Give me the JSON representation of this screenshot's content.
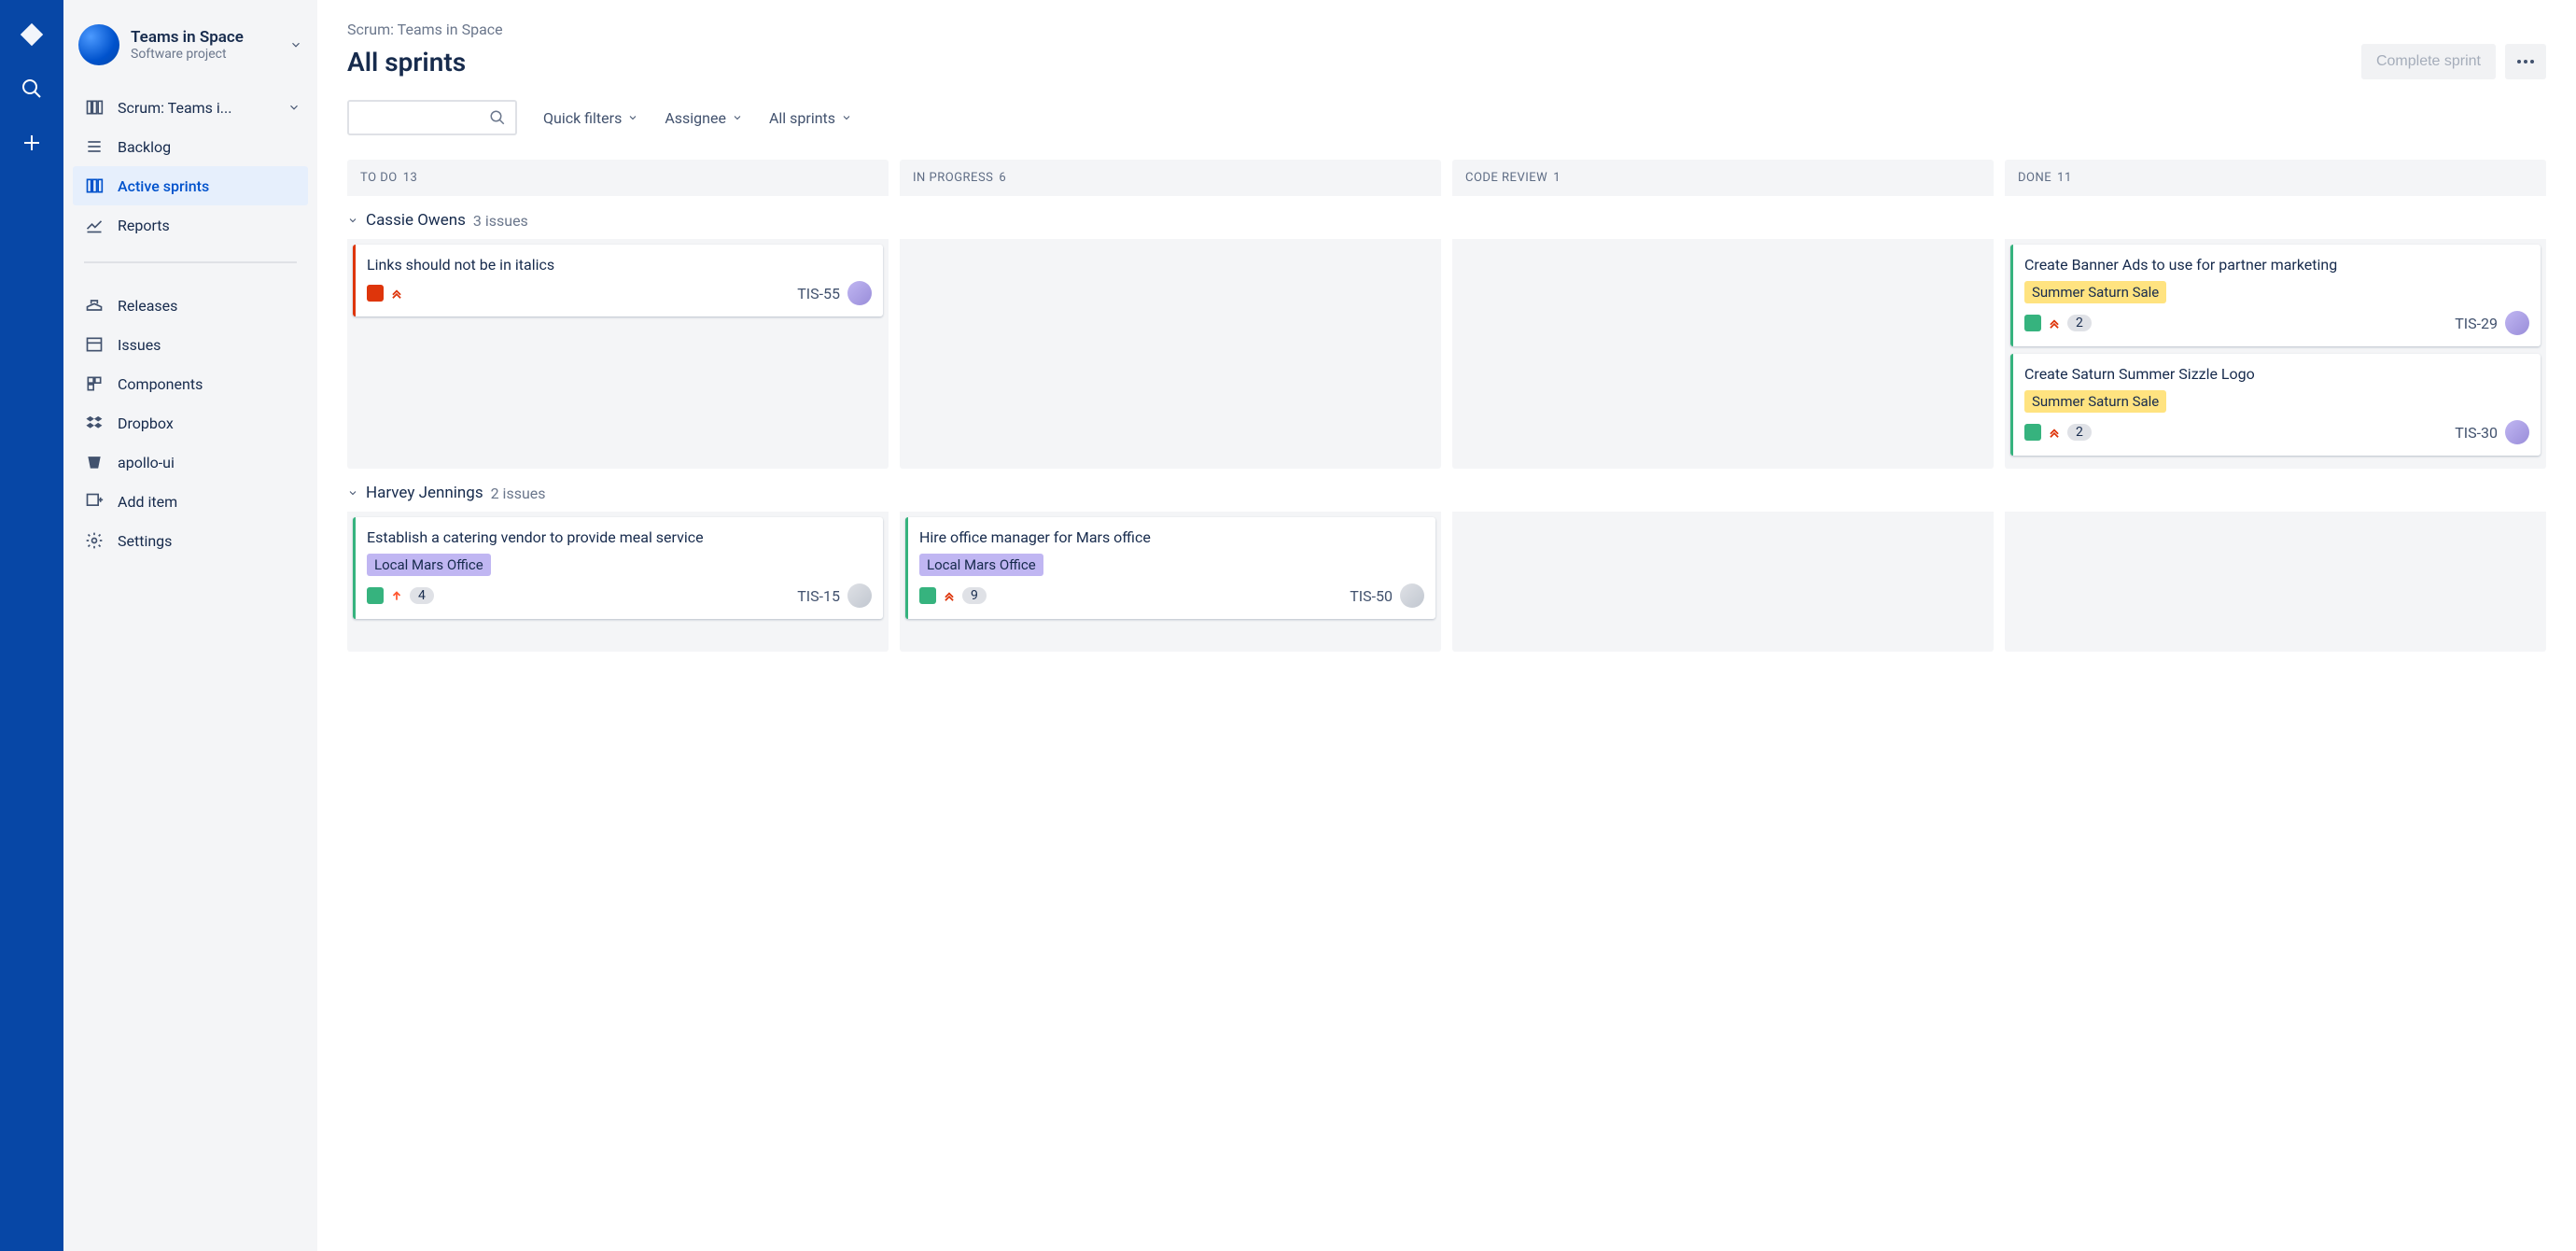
{
  "project": {
    "name": "Teams in Space",
    "subtitle": "Software project"
  },
  "sidebar": {
    "scrum_label": "Scrum: Teams i...",
    "nav": {
      "backlog": "Backlog",
      "active_sprints": "Active sprints",
      "reports": "Reports",
      "releases": "Releases",
      "issues": "Issues",
      "components": "Components",
      "dropbox": "Dropbox",
      "apollo": "apollo-ui",
      "add_item": "Add item",
      "settings": "Settings"
    }
  },
  "header": {
    "breadcrumb": "Scrum: Teams in Space",
    "title": "All sprints",
    "complete_sprint": "Complete sprint"
  },
  "filters": {
    "quick_filters": "Quick filters",
    "assignee": "Assignee",
    "all_sprints": "All sprints"
  },
  "columns": [
    {
      "name": "TO DO",
      "count": "13"
    },
    {
      "name": "IN PROGRESS",
      "count": "6"
    },
    {
      "name": "CODE REVIEW",
      "count": "1"
    },
    {
      "name": "DONE",
      "count": "11"
    }
  ],
  "swimlanes": [
    {
      "name": "Cassie Owens",
      "count_label": "3 issues",
      "cards": {
        "todo": [
          {
            "title": "Links should not be in italics",
            "key": "TIS-55",
            "type": "bug",
            "prio": "highest",
            "border": "red"
          }
        ],
        "in_progress": [],
        "code_review": [],
        "done": [
          {
            "title": "Create Banner Ads to use for partner marketing",
            "label": "Summer Saturn Sale",
            "label_color": "#FFE380",
            "key": "TIS-29",
            "type": "story",
            "prio": "highest",
            "badge": "2",
            "border": "green"
          },
          {
            "title": "Create Saturn Summer Sizzle Logo",
            "label": "Summer Saturn Sale",
            "label_color": "#FFE380",
            "key": "TIS-30",
            "type": "story",
            "prio": "highest",
            "badge": "2",
            "border": "green"
          }
        ]
      }
    },
    {
      "name": "Harvey Jennings",
      "count_label": "2 issues",
      "cards": {
        "todo": [
          {
            "title": "Establish a catering vendor to provide meal service",
            "label": "Local Mars Office",
            "label_color": "#C0B6F2",
            "key": "TIS-15",
            "type": "story",
            "prio": "medium",
            "badge": "4",
            "border": "green",
            "avatar": "gray"
          }
        ],
        "in_progress": [
          {
            "title": "Hire office manager for Mars office",
            "label": "Local Mars Office",
            "label_color": "#C0B6F2",
            "key": "TIS-50",
            "type": "story",
            "prio": "highest",
            "badge": "9",
            "border": "green",
            "avatar": "gray"
          }
        ],
        "code_review": [],
        "done": []
      }
    }
  ]
}
